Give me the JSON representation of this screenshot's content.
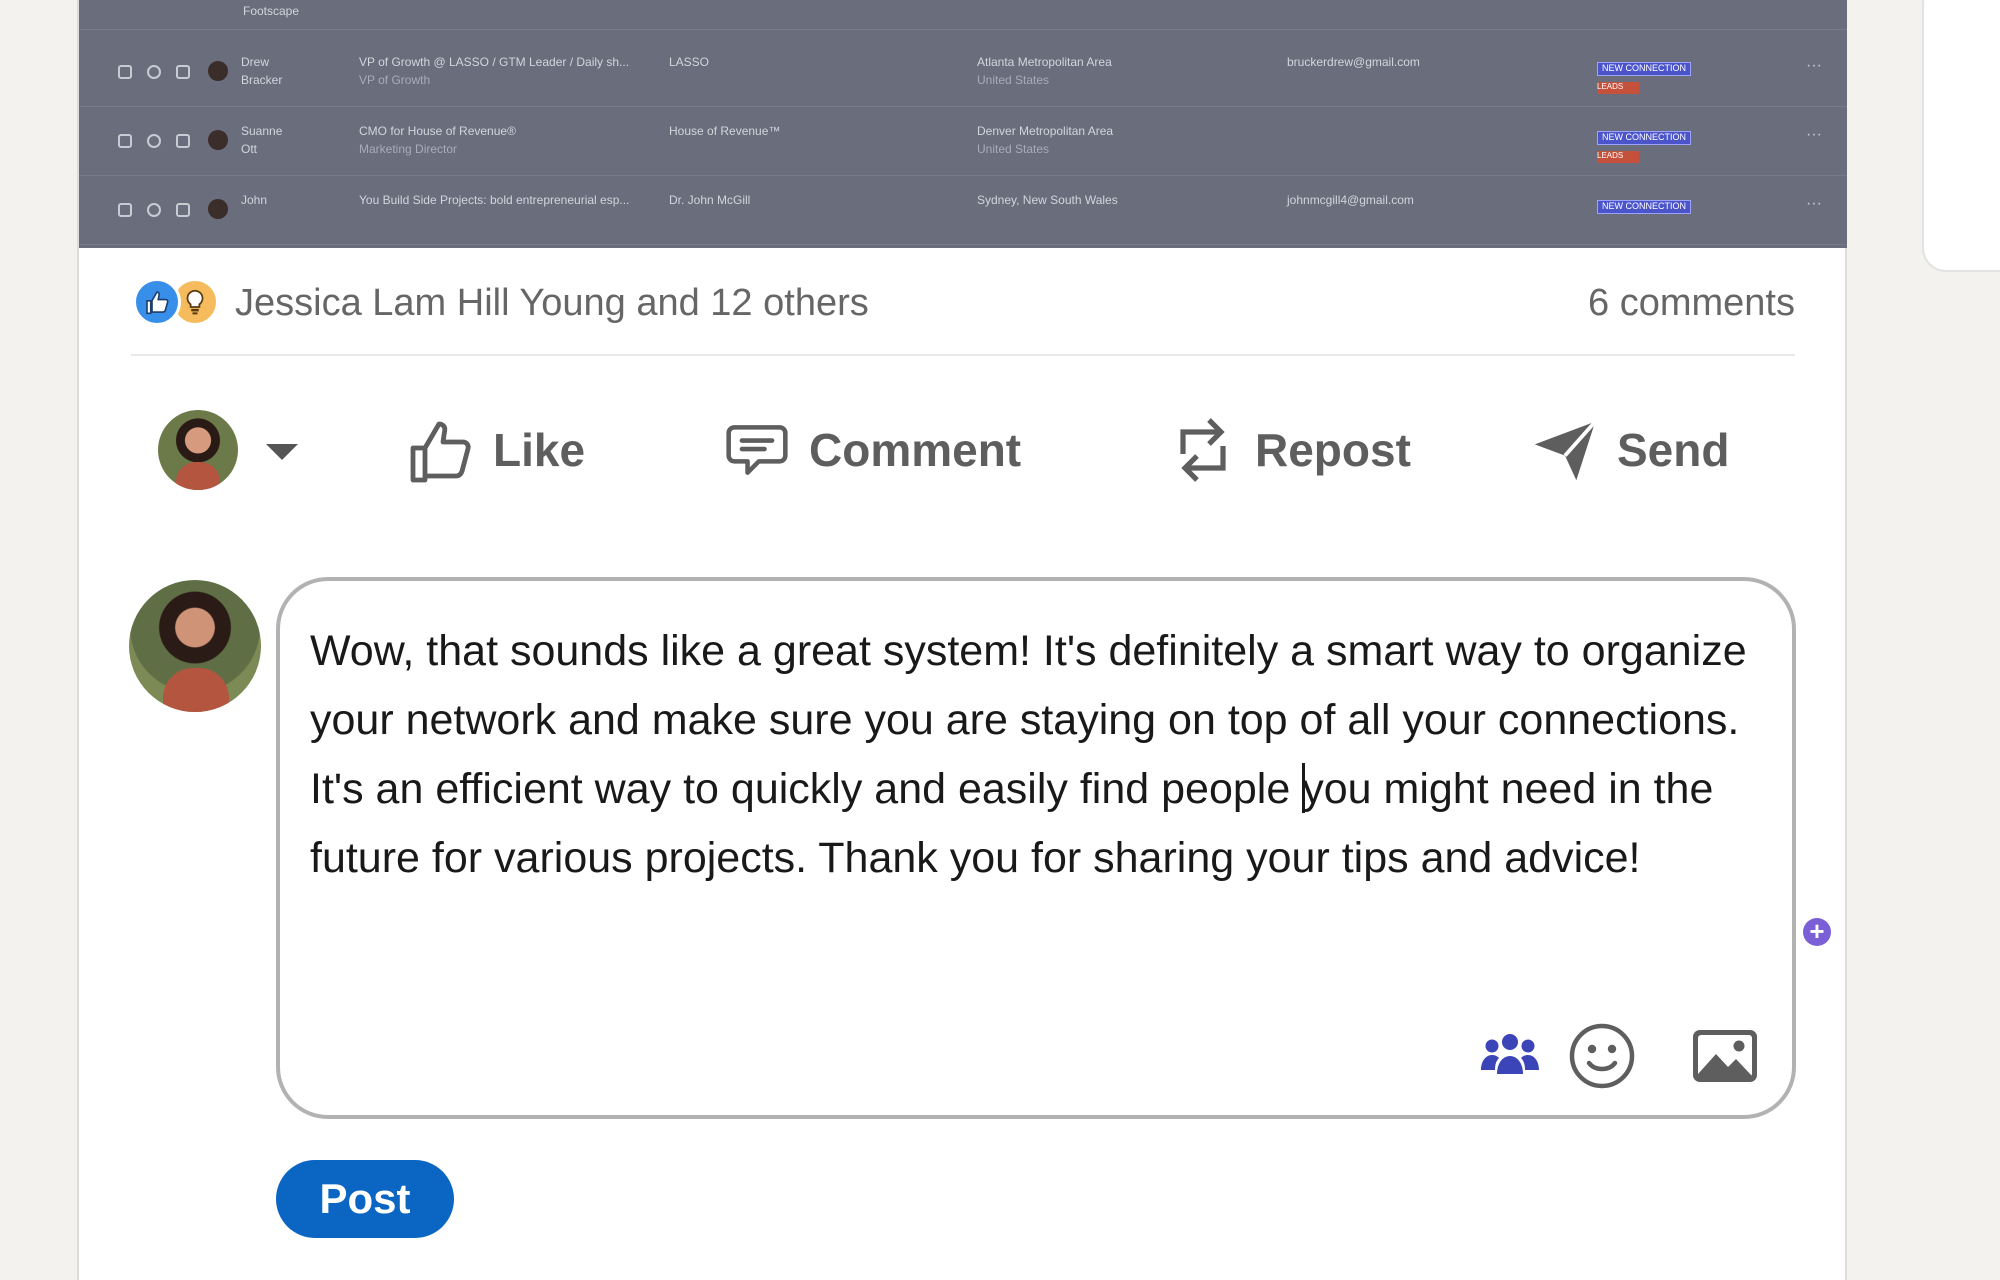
{
  "embed": {
    "rows": [
      {
        "name": "Drew",
        "name2": "Bracker",
        "headline": "VP of Growth @ LASSO / GTM Leader / Daily sh...",
        "sub": "VP of Growth",
        "company": "LASSO",
        "location": "Atlanta Metropolitan Area",
        "location2": "United States",
        "email": "bruckerdrew@gmail.com",
        "badge": "NEW CONNECTION",
        "badge2": "LEADS"
      },
      {
        "name": "Suanne",
        "name2": "Ott",
        "headline": "CMO for House of Revenue®",
        "sub": "Marketing Director",
        "company": "House of Revenue™",
        "location": "Denver Metropolitan Area",
        "location2": "United States",
        "email": "",
        "badge": "NEW CONNECTION",
        "badge2": "LEADS"
      },
      {
        "name": "John",
        "name2": "",
        "headline": "You Build Side Projects: bold entrepreneurial esp...",
        "sub": "",
        "company": "Dr. John McGill",
        "location": "Sydney, New South Wales",
        "location2": "",
        "email": "johnmcgill4@gmail.com",
        "badge": "NEW CONNECTION",
        "badge2": ""
      }
    ],
    "top_label": "Footscape"
  },
  "social": {
    "reactions_text": "Jessica Lam Hill Young and 12 others",
    "comments_text": "6 comments",
    "reaction_icons": [
      "like-icon",
      "insightful-icon"
    ]
  },
  "actions": {
    "like": "Like",
    "comment": "Comment",
    "repost": "Repost",
    "send": "Send"
  },
  "composer": {
    "text_before_caret": "Wow, that sounds like a great system! It's definitely a smart way to organize your network and make sure you are staying on top of all your connections. It's an efficient way to quickly and easily find people ",
    "text_after_caret": "you might need in the future for various projects. Thank you for sharing your tips and advice!",
    "grammar_symbol": "+"
  },
  "post_button": "Post",
  "colors": {
    "brand": "#0a66c2",
    "mention_icon": "#3b45b8",
    "grammar_icon": "#7b5fd6"
  }
}
